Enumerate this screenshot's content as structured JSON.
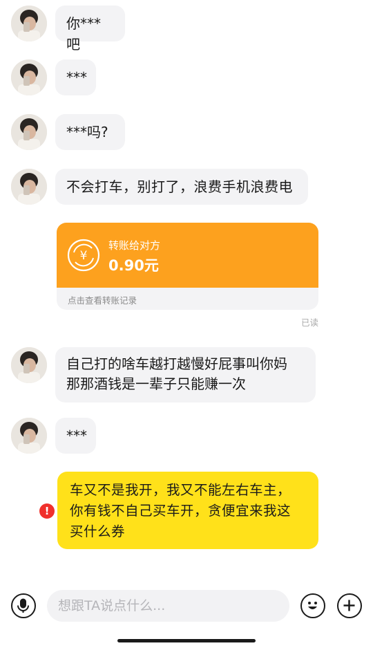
{
  "messages": [
    {
      "sender": "other",
      "text": "你***吧"
    },
    {
      "sender": "other",
      "text": "***"
    },
    {
      "sender": "other",
      "text": "***吗?"
    },
    {
      "sender": "other",
      "text": "不会打车，别打了，浪费手机浪费电"
    },
    {
      "sender": "other",
      "text": "自己打的啥车越打越慢好屁事叫你妈\n那那酒钱是一辈子只能赚一次"
    },
    {
      "sender": "other",
      "text": "***"
    },
    {
      "sender": "me",
      "text": "车又不是我开，我又不能左右车主，\n你有钱不自己买车开，贪便宜来我这\n买什么券",
      "status": "failed"
    }
  ],
  "transfer": {
    "label": "转账给对方",
    "amount": "0.90元",
    "footer": "点击查看转账记录",
    "status": "已读",
    "color": "#fda11e"
  },
  "input_bar": {
    "placeholder": "想跟TA说点什么...",
    "left_icon": "microphone-icon",
    "right_icons": [
      "emoji-icon",
      "plus-icon"
    ]
  },
  "colors": {
    "my_bubble": "#ffe11a",
    "other_bubble": "#f3f3f5",
    "error": "#f0302c"
  }
}
